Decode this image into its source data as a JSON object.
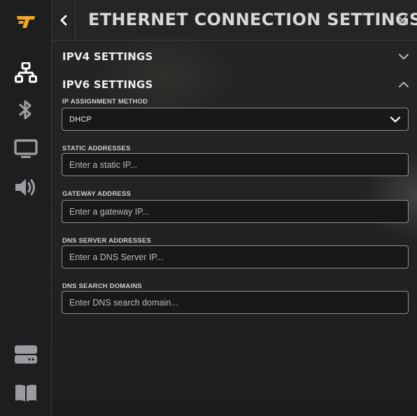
{
  "header": {
    "title": "ETHERNET CONNECTION SETTINGS"
  },
  "sidebar": {
    "logo": "steam-tinker-logo",
    "items": [
      {
        "icon": "network-icon",
        "active": true
      },
      {
        "icon": "bluetooth-icon",
        "active": false
      },
      {
        "icon": "display-icon",
        "active": false
      },
      {
        "icon": "audio-icon",
        "active": false
      },
      {
        "icon": "storage-icon",
        "active": false
      },
      {
        "icon": "book-icon",
        "active": false
      }
    ]
  },
  "sections": {
    "ipv4": {
      "title": "IPV4 SETTINGS",
      "expanded": false
    },
    "ipv6": {
      "title": "IPV6 SETTINGS",
      "expanded": true
    }
  },
  "fields": {
    "assignment": {
      "label": "IP ASSIGNMENT METHOD",
      "value": "DHCP"
    },
    "static": {
      "label": "STATIC ADDRESSES",
      "placeholder": "Enter a static IP..."
    },
    "gateway": {
      "label": "GATEWAY ADDRESS",
      "placeholder": "Enter a gateway IP..."
    },
    "dns_servers": {
      "label": "DNS SERVER ADDRESSES",
      "placeholder": "Enter a DNS Server IP..."
    },
    "dns_search": {
      "label": "DNS SEARCH DOMAINS",
      "placeholder": "Enter DNS search domain..."
    }
  },
  "colors": {
    "accent": "#f5a623",
    "icon_active": "#ffffff",
    "icon_inactive": "#9a9c9f"
  }
}
